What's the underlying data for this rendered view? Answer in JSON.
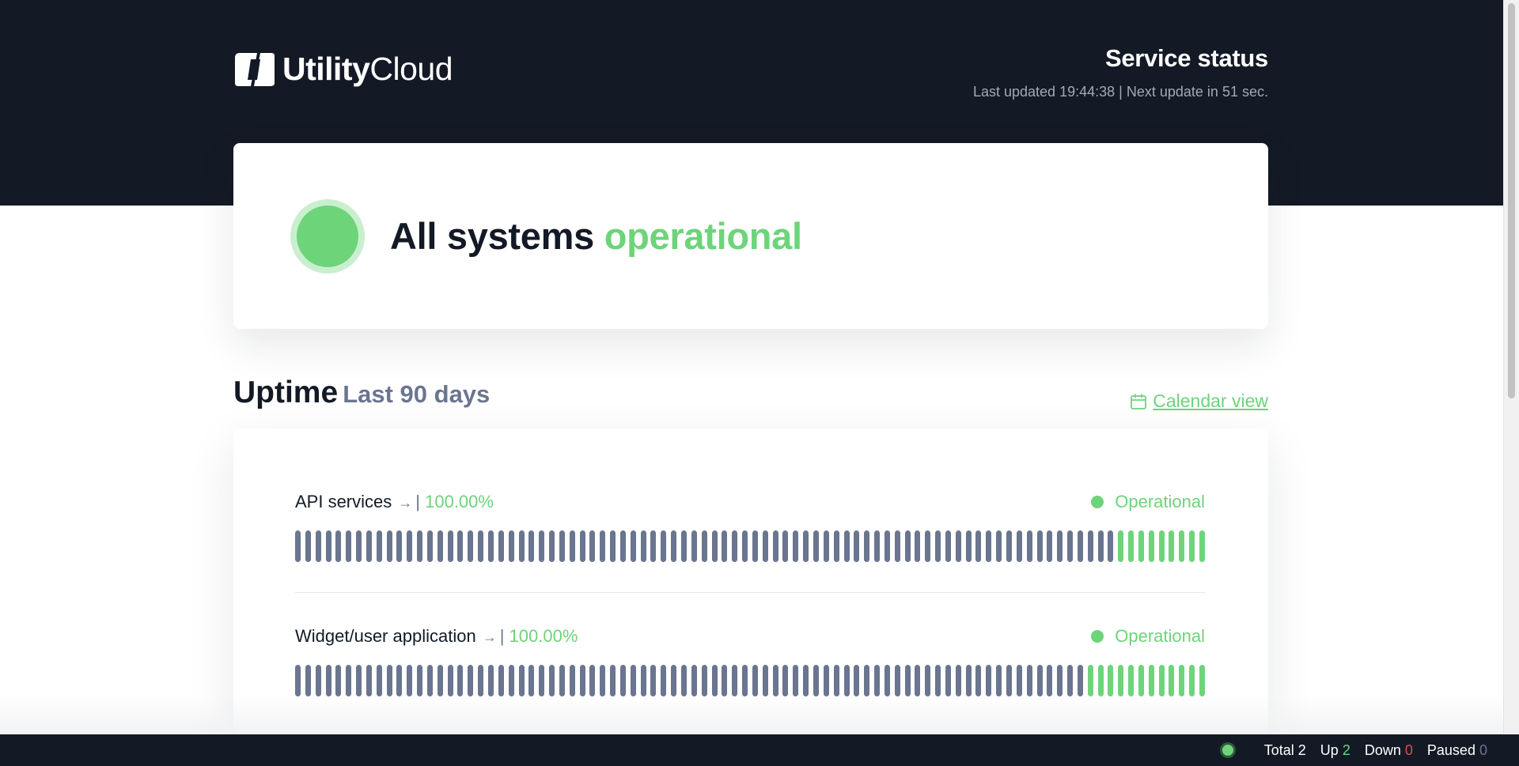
{
  "brand": {
    "logo_text_bold": "Utility",
    "logo_text_light": "Cloud",
    "logo_icon": "hexagon-logo-icon"
  },
  "header": {
    "title": "Service status",
    "last_updated_label": "Last updated",
    "last_updated_time": "19:44:38",
    "next_update_label": "Next update in",
    "next_update_value": "51 sec."
  },
  "hero": {
    "prefix": "All systems",
    "status": "operational",
    "status_color": "#6dd47a"
  },
  "uptime": {
    "title": "Uptime",
    "subtitle": "Last 90 days",
    "calendar_link": "Calendar view",
    "calendar_icon": "calendar-icon"
  },
  "monitors": [
    {
      "name": "API services",
      "uptime": "100.00%",
      "status": "Operational",
      "bars_total": 90,
      "bars_up": 9
    },
    {
      "name": "Widget/user application",
      "uptime": "100.00%",
      "status": "Operational",
      "bars_total": 90,
      "bars_up": 12
    }
  ],
  "footer": {
    "total_label": "Total",
    "total_value": "2",
    "up_label": "Up",
    "up_value": "2",
    "down_label": "Down",
    "down_value": "0",
    "paused_label": "Paused",
    "paused_value": "0"
  },
  "colors": {
    "dark": "#131a26",
    "green": "#6dd47a",
    "slate": "#6a7590",
    "red": "#e5484d"
  }
}
